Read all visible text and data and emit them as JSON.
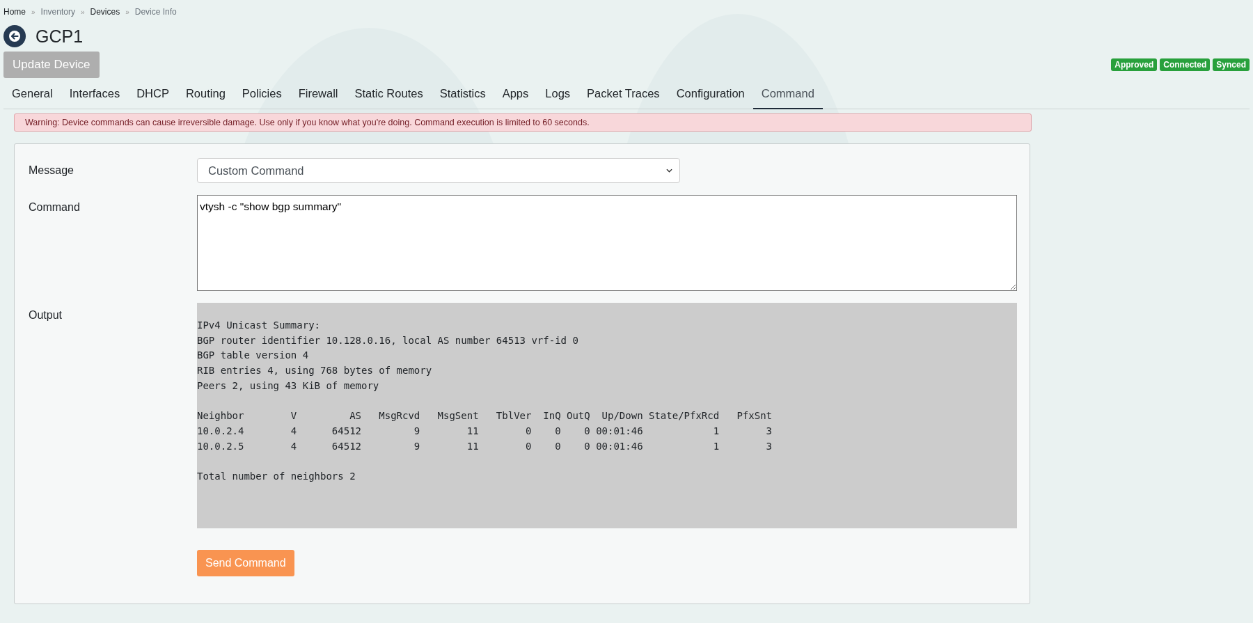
{
  "breadcrumb": [
    {
      "label": "Home",
      "muted": false
    },
    {
      "label": "Inventory",
      "muted": true
    },
    {
      "label": "Devices",
      "muted": false
    },
    {
      "label": "Device Info",
      "muted": true
    }
  ],
  "breadcrumb_separator": "»",
  "title": "GCP1",
  "update_button": {
    "label": "Update Device",
    "disabled": true
  },
  "badges": [
    "Approved",
    "Connected",
    "Synced"
  ],
  "tabs": [
    {
      "label": "General",
      "selected": false
    },
    {
      "label": "Interfaces",
      "selected": false
    },
    {
      "label": "DHCP",
      "selected": false
    },
    {
      "label": "Routing",
      "selected": false
    },
    {
      "label": "Policies",
      "selected": false
    },
    {
      "label": "Firewall",
      "selected": false
    },
    {
      "label": "Static Routes",
      "selected": false
    },
    {
      "label": "Statistics",
      "selected": false
    },
    {
      "label": "Apps",
      "selected": false
    },
    {
      "label": "Logs",
      "selected": false
    },
    {
      "label": "Packet Traces",
      "selected": false
    },
    {
      "label": "Configuration",
      "selected": false
    },
    {
      "label": "Command",
      "selected": true
    }
  ],
  "warning": "Warning: Device commands can cause irreversible damage. Use only if you know what you're doing. Command execution is limited to 60 seconds.",
  "form": {
    "message_label": "Message",
    "message_value": "Custom Command",
    "command_label": "Command",
    "command_value": "vtysh -c \"show bgp summary\"",
    "output_label": "Output",
    "output_blocks": [
      [
        "IPv4 Unicast Summary:",
        "BGP router identifier 10.128.0.16, local AS number 64513 vrf-id 0",
        "BGP table version 4",
        "RIB entries 4, using 768 bytes of memory",
        "Peers 2, using 43 KiB of memory"
      ],
      [
        "Neighbor        V         AS   MsgRcvd   MsgSent   TblVer  InQ OutQ  Up/Down State/PfxRcd   PfxSnt",
        "10.0.2.4        4      64512         9        11        0    0    0 00:01:46            1        3",
        "10.0.2.5        4      64512         9        11        0    0    0 00:01:46            1        3"
      ],
      [
        "Total number of neighbors 2"
      ]
    ],
    "send_button": "Send Command"
  }
}
